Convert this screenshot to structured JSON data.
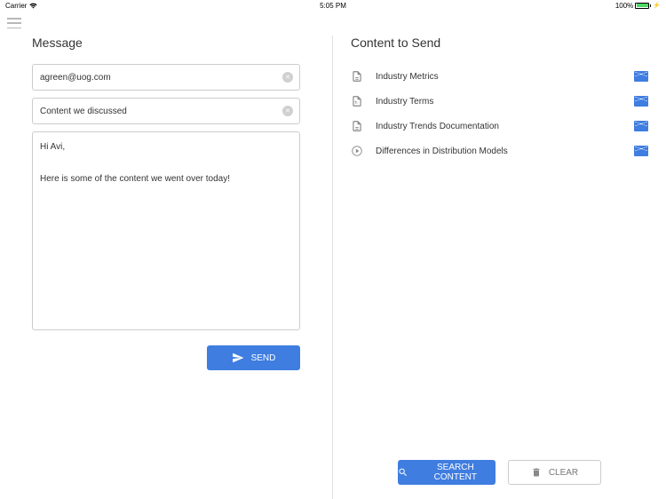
{
  "statusBar": {
    "carrier": "Carrier",
    "time": "5:05 PM",
    "battery": "100%"
  },
  "leftPanel": {
    "title": "Message",
    "emailValue": "agreen@uog.com",
    "subjectValue": "Content we discussed",
    "bodyValue": "Hi Avi,\n\nHere is some of the content we went over today!",
    "sendLabel": "SEND"
  },
  "rightPanel": {
    "title": "Content to Send",
    "items": [
      {
        "label": "Industry Metrics",
        "icon": "document"
      },
      {
        "label": "Industry Terms",
        "icon": "pdf"
      },
      {
        "label": "Industry Trends Documentation",
        "icon": "document"
      },
      {
        "label": "Differences in Distribution Models",
        "icon": "video"
      }
    ],
    "searchLabel": "SEARCH CONTENT",
    "clearLabel": "CLEAR"
  }
}
